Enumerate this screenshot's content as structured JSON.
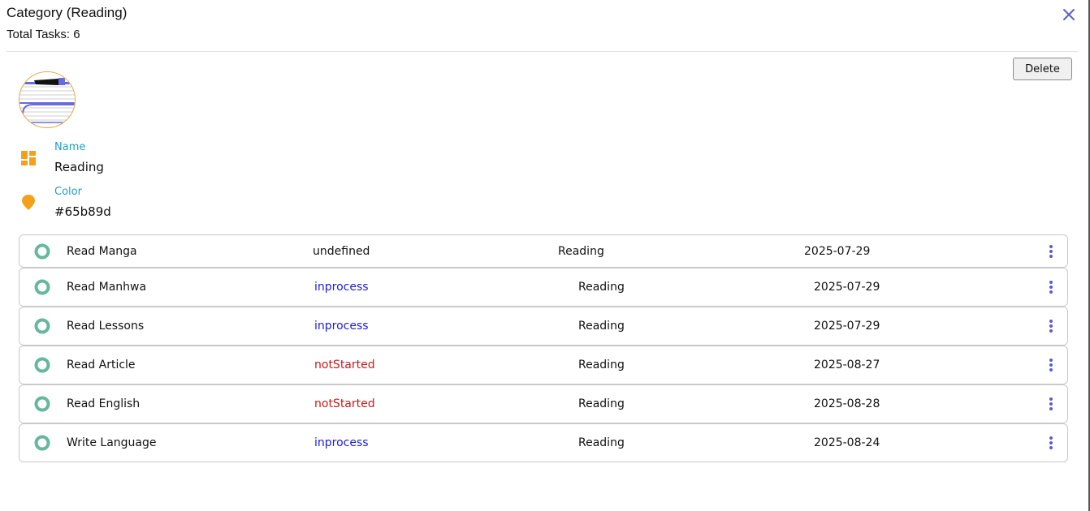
{
  "header": {
    "title": "Category (Reading)",
    "total_tasks": "Total Tasks: 6"
  },
  "actions": {
    "delete_label": "Delete"
  },
  "category": {
    "name_label": "Name",
    "name_value": "Reading",
    "color_label": "Color",
    "color_value": "#65b89d"
  },
  "colors": {
    "accent": "#5b5bd6",
    "label": "#1f9fc7",
    "icon": "#f5a01a",
    "status_dot": "#65b89d",
    "inprocess": "#1b1bd6",
    "notStarted": "#c71a1a"
  },
  "tasks": [
    {
      "name": "Read Manga",
      "status": "undefined",
      "category": "Reading",
      "date": "2025-07-29"
    },
    {
      "name": "Read Manhwa",
      "status": "inprocess",
      "category": "Reading",
      "date": "2025-07-29"
    },
    {
      "name": "Read Lessons",
      "status": "inprocess",
      "category": "Reading",
      "date": "2025-07-29"
    },
    {
      "name": "Read Article",
      "status": "notStarted",
      "category": "Reading",
      "date": "2025-08-27"
    },
    {
      "name": "Read English",
      "status": "notStarted",
      "category": "Reading",
      "date": "2025-08-28"
    },
    {
      "name": "Write Language",
      "status": "inprocess",
      "category": "Reading",
      "date": "2025-08-24"
    }
  ]
}
